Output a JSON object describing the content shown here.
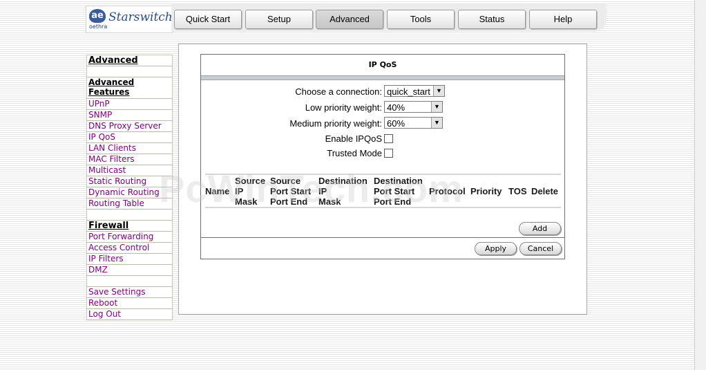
{
  "brand": {
    "mark": "ae",
    "company": "oethra",
    "product": "Starswitch"
  },
  "nav": {
    "tabs": [
      {
        "label": "Quick Start"
      },
      {
        "label": "Setup"
      },
      {
        "label": "Advanced"
      },
      {
        "label": "Tools"
      },
      {
        "label": "Status"
      },
      {
        "label": "Help"
      }
    ],
    "active": "Advanced"
  },
  "sidebar": {
    "title": "Advanced",
    "section_features": "Advanced Features",
    "features": [
      "UPnP",
      "SNMP",
      "DNS Proxy Server",
      "IP QoS",
      "LAN Clients",
      "MAC Filters",
      "Multicast",
      "Static Routing",
      "Dynamic Routing",
      "Routing Table"
    ],
    "section_firewall": "Firewall",
    "firewall": [
      "Port Forwarding",
      "Access Control",
      "IP Filters",
      "DMZ"
    ],
    "actions": [
      "Save Settings",
      "Reboot",
      "Log Out"
    ]
  },
  "panel": {
    "title": "IP QoS",
    "connection_label": "Choose a connection:",
    "connection_value": "quick_start",
    "low_label": "Low priority weight:",
    "low_value": "40%",
    "medium_label": "Medium priority weight:",
    "medium_value": "60%",
    "enable_label": "Enable IPQoS",
    "enable_checked": false,
    "trusted_label": "Trusted Mode",
    "trusted_checked": false,
    "table_headers": {
      "name": "Name",
      "source_ip": "Source\nIP\nMask",
      "source_port": "Source\nPort Start\nPort End",
      "dest_ip": "Destination\nIP\nMask",
      "dest_port": "Destination\nPort Start\nPort End",
      "protocol": "Protocol",
      "priority": "Priority",
      "tos": "TOS",
      "delete": "Delete"
    },
    "add_label": "Add",
    "apply_label": "Apply",
    "cancel_label": "Cancel"
  },
  "watermark": "PcWinTech.com",
  "colors": {
    "link": "#800080",
    "bar": "#c9ccd2",
    "border": "#6d6d6d"
  }
}
